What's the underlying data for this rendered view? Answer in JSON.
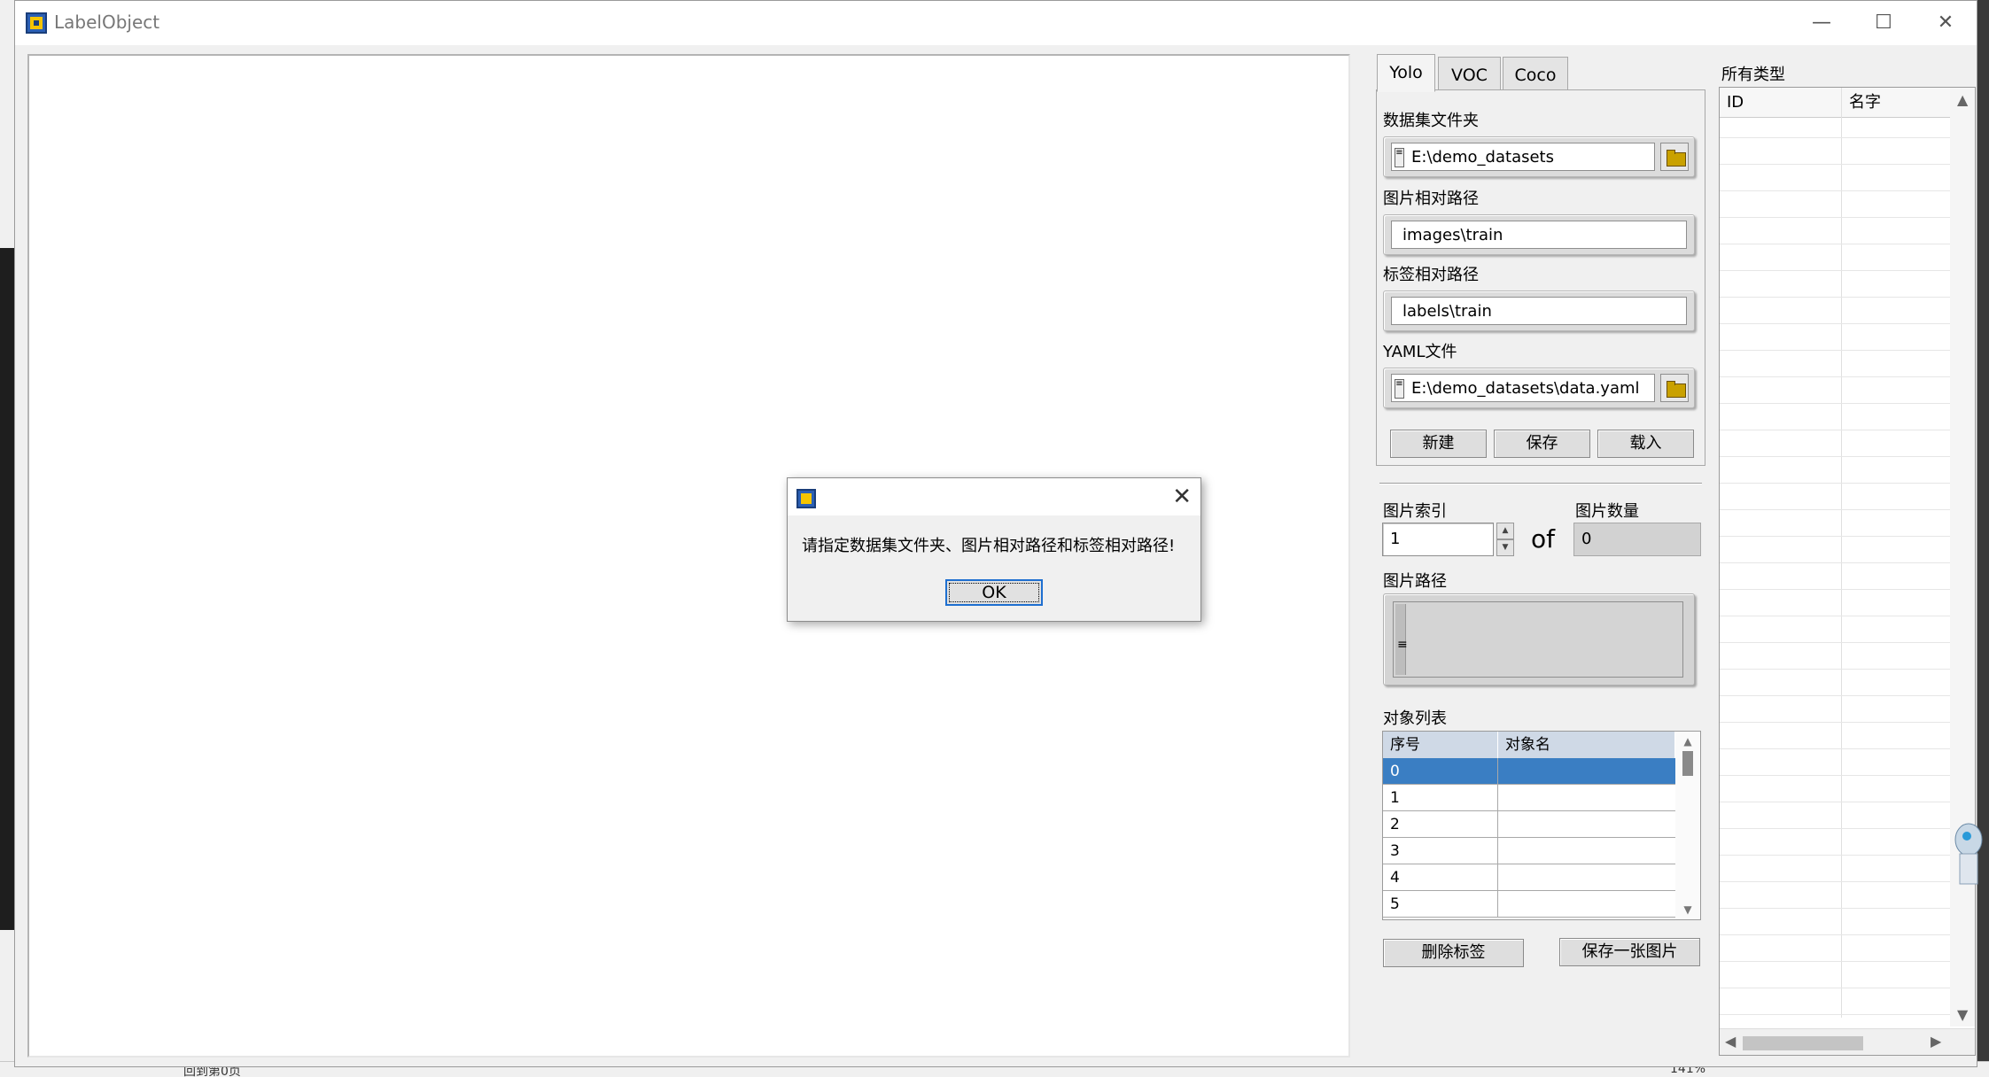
{
  "window": {
    "title": "LabelObject"
  },
  "tabs": [
    {
      "label": "Yolo",
      "active": true
    },
    {
      "label": "VOC",
      "active": false
    },
    {
      "label": "Coco",
      "active": false
    }
  ],
  "yolo": {
    "dataset_folder_label": "数据集文件夹",
    "dataset_folder_value": "E:\\demo_datasets",
    "image_rel_path_label": "图片相对路径",
    "image_rel_path_value": "images\\train",
    "label_rel_path_label": "标签相对路径",
    "label_rel_path_value": "labels\\train",
    "yaml_label": "YAML文件",
    "yaml_value": "E:\\demo_datasets\\data.yaml",
    "new_button": "新建",
    "save_button": "保存",
    "load_button": "载入"
  },
  "navigation": {
    "index_label": "图片索引",
    "index_value": "1",
    "of_text": "of",
    "count_label": "图片数量",
    "count_value": "0",
    "image_path_label": "图片路径"
  },
  "object_list": {
    "label": "对象列表",
    "columns": [
      "序号",
      "对象名"
    ],
    "rows": [
      "0",
      "1",
      "2",
      "3",
      "4",
      "5"
    ],
    "selected_row": 0
  },
  "actions": {
    "delete_label_button": "删除标签",
    "save_image_button": "保存一张图片"
  },
  "types_panel": {
    "label": "所有类型",
    "columns": [
      "ID",
      "名字"
    ]
  },
  "dialog": {
    "message": "请指定数据集文件夹、图片相对路径和标签相对路径!",
    "ok_button": "OK"
  },
  "background": {
    "taskbar_text": "回到第0页",
    "zoom_text": "141%"
  },
  "colors": {
    "selection": "#3a7ec3",
    "header": "#cfd9e6",
    "dialog_focus": "#1e6fd0"
  }
}
